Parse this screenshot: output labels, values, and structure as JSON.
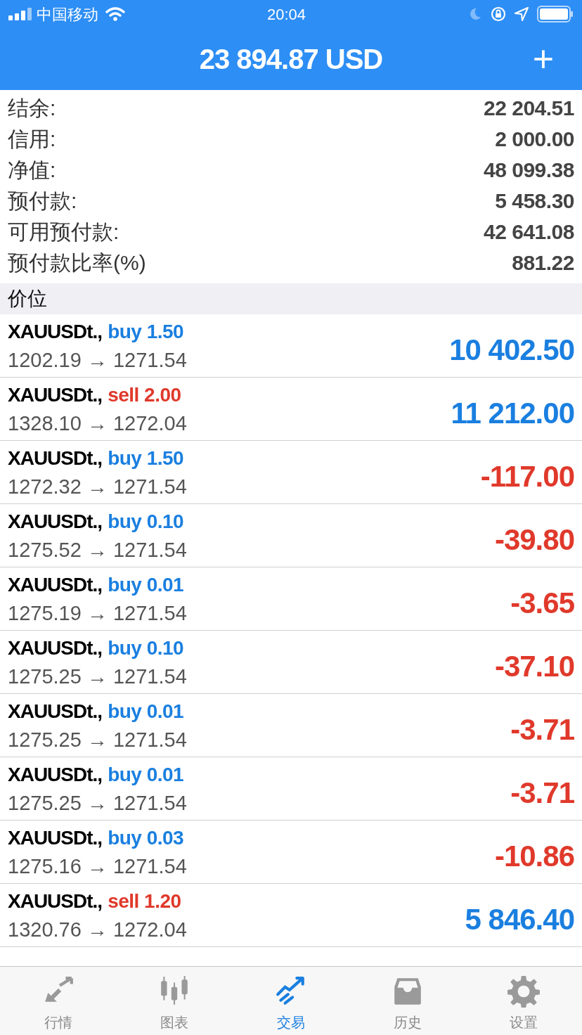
{
  "status_bar": {
    "carrier": "中国移动",
    "time": "20:04"
  },
  "header": {
    "title": "23 894.87 USD",
    "add": "+"
  },
  "summary": [
    {
      "label": "结余:",
      "value": "22 204.51"
    },
    {
      "label": "信用:",
      "value": "2 000.00"
    },
    {
      "label": "净值:",
      "value": "48 099.38"
    },
    {
      "label": "预付款:",
      "value": "5 458.30"
    },
    {
      "label": "可用预付款:",
      "value": "42 641.08"
    },
    {
      "label": "预付款比率(%)",
      "value": "881.22"
    }
  ],
  "section_title": "价位",
  "positions": [
    {
      "symbol": "XAUUSDt.,",
      "side": "buy 1.50",
      "kind": "buy",
      "prices": "1202.19 → 1271.54",
      "profit": "10 402.50",
      "profit_positive": true
    },
    {
      "symbol": "XAUUSDt.,",
      "side": "sell 2.00",
      "kind": "sell",
      "prices": "1328.10 → 1272.04",
      "profit": "11 212.00",
      "profit_positive": true
    },
    {
      "symbol": "XAUUSDt.,",
      "side": "buy 1.50",
      "kind": "buy",
      "prices": "1272.32 → 1271.54",
      "profit": "-117.00",
      "profit_positive": false
    },
    {
      "symbol": "XAUUSDt.,",
      "side": "buy 0.10",
      "kind": "buy",
      "prices": "1275.52 → 1271.54",
      "profit": "-39.80",
      "profit_positive": false
    },
    {
      "symbol": "XAUUSDt.,",
      "side": "buy 0.01",
      "kind": "buy",
      "prices": "1275.19 → 1271.54",
      "profit": "-3.65",
      "profit_positive": false
    },
    {
      "symbol": "XAUUSDt.,",
      "side": "buy 0.10",
      "kind": "buy",
      "prices": "1275.25 → 1271.54",
      "profit": "-37.10",
      "profit_positive": false
    },
    {
      "symbol": "XAUUSDt.,",
      "side": "buy 0.01",
      "kind": "buy",
      "prices": "1275.25 → 1271.54",
      "profit": "-3.71",
      "profit_positive": false
    },
    {
      "symbol": "XAUUSDt.,",
      "side": "buy 0.01",
      "kind": "buy",
      "prices": "1275.25 → 1271.54",
      "profit": "-3.71",
      "profit_positive": false
    },
    {
      "symbol": "XAUUSDt.,",
      "side": "buy 0.03",
      "kind": "buy",
      "prices": "1275.16 → 1271.54",
      "profit": "-10.86",
      "profit_positive": false
    },
    {
      "symbol": "XAUUSDt.,",
      "side": "sell 1.20",
      "kind": "sell",
      "prices": "1320.76 → 1272.04",
      "profit": "5 846.40",
      "profit_positive": true
    }
  ],
  "tabs": [
    {
      "label": "行情",
      "kind": "quotes",
      "selected": false
    },
    {
      "label": "图表",
      "kind": "chart",
      "selected": false
    },
    {
      "label": "交易",
      "kind": "trade",
      "selected": true
    },
    {
      "label": "历史",
      "kind": "history",
      "selected": false
    },
    {
      "label": "设置",
      "kind": "settings",
      "selected": false
    }
  ]
}
